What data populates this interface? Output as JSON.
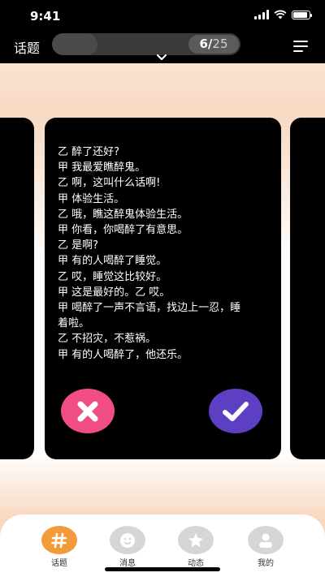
{
  "status": {
    "time": "9:41"
  },
  "header": {
    "title": "话题",
    "progress": {
      "current": "6",
      "separator": "/",
      "total": "25",
      "fraction": 0.24
    }
  },
  "card": {
    "lines": [
      "乙 醉了还好?",
      "甲 我最爱瞧醉鬼。",
      "乙 啊，这叫什么话啊!",
      "甲 体验生活。",
      "乙 哦，瞧这醉鬼体验生活。",
      "甲 你看，你喝醉了有意思。",
      "乙 是啊?",
      "甲 有的人喝醉了睡觉。",
      "乙 哎，睡觉这比较好。",
      "甲 这是最好的。乙 哎。",
      "甲 喝醉了一声不言语，找边上一忍，睡",
      "着啦。",
      "乙 不招灾，不惹祸。",
      "甲 有的人喝醉了，他还乐。"
    ]
  },
  "colors": {
    "reject": "#f04c85",
    "accept": "#5d3fc4",
    "active_tab": "#f39a3a",
    "inactive_tab": "#d6d6d6"
  },
  "tabs": [
    {
      "label": "话题",
      "icon": "hash-icon",
      "active": true
    },
    {
      "label": "消息",
      "icon": "smiley-icon",
      "active": false
    },
    {
      "label": "动态",
      "icon": "star-icon",
      "active": false
    },
    {
      "label": "我的",
      "icon": "user-icon",
      "active": false
    }
  ]
}
